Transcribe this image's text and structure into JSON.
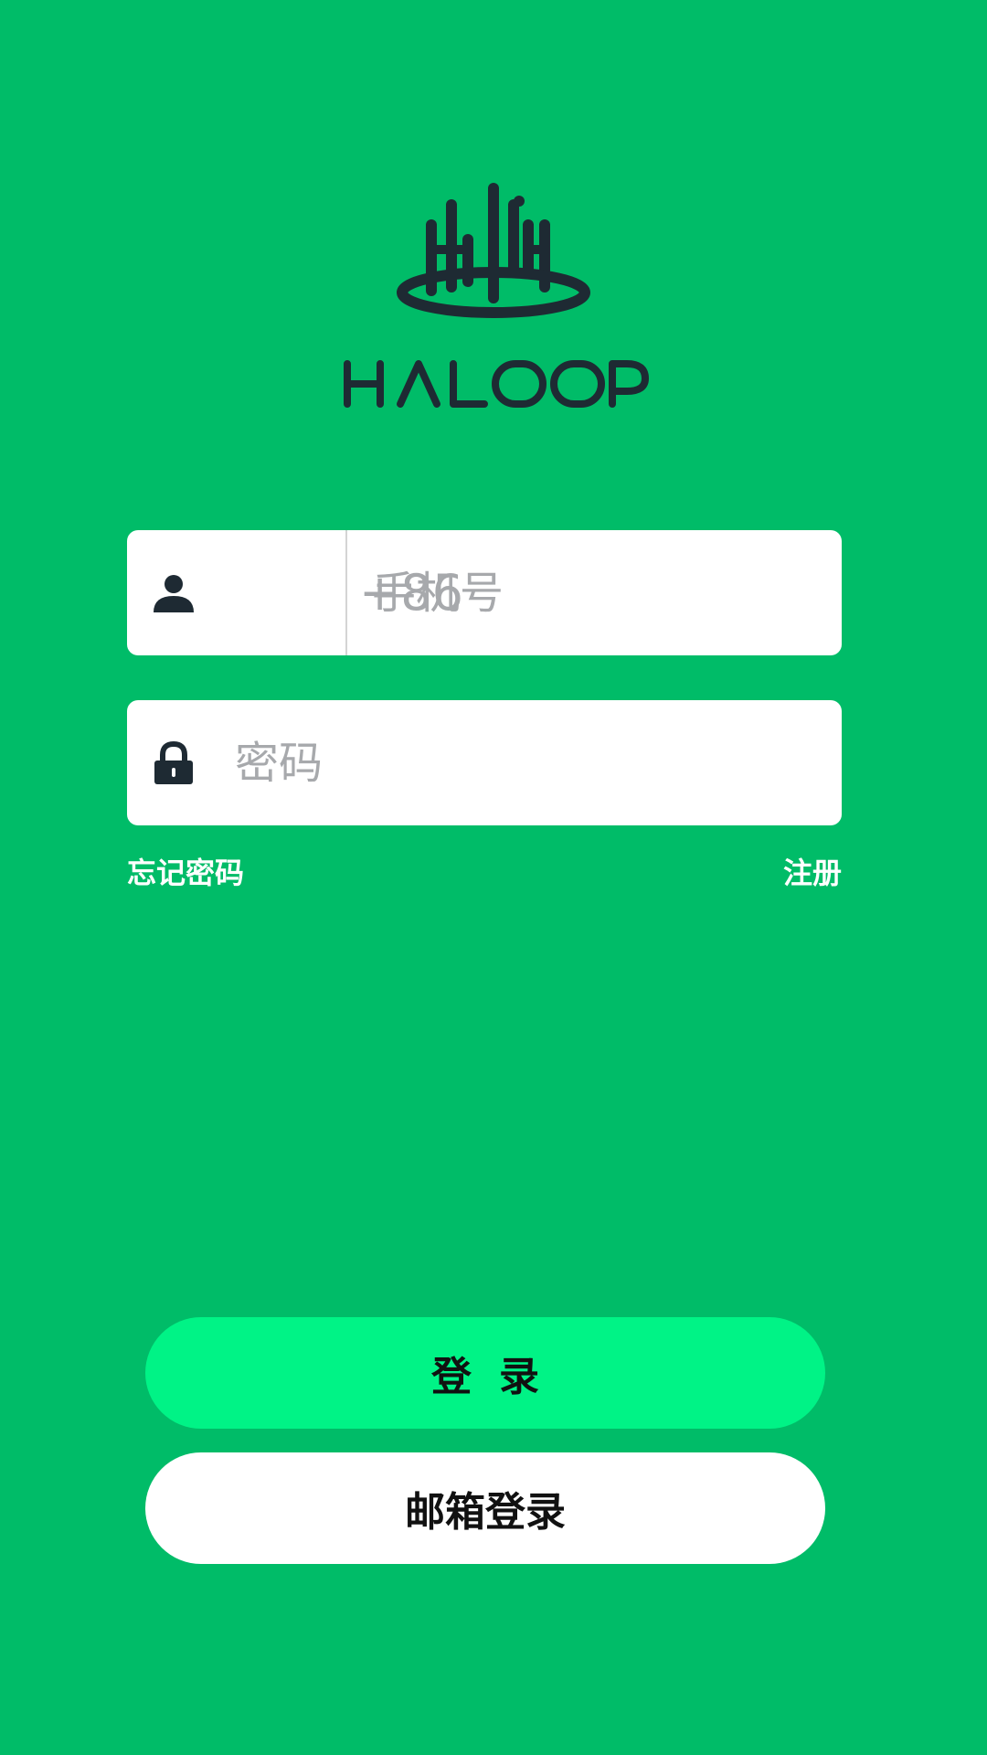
{
  "brand": {
    "name": "HALOOP",
    "logo_color": "#1E2A33"
  },
  "colors": {
    "background": "#00BC68",
    "primary_button": "#00F386",
    "secondary_button": "#FFFFFF",
    "placeholder": "#A7A9AC"
  },
  "phone_field": {
    "icon": "user-icon",
    "country_code": "+86",
    "placeholder": "手机号",
    "value": ""
  },
  "password_field": {
    "icon": "lock-icon",
    "placeholder": "密码",
    "value": ""
  },
  "links": {
    "forgot_password": "忘记密码",
    "register": "注册"
  },
  "buttons": {
    "login": "登录",
    "email_login": "邮箱登录"
  }
}
